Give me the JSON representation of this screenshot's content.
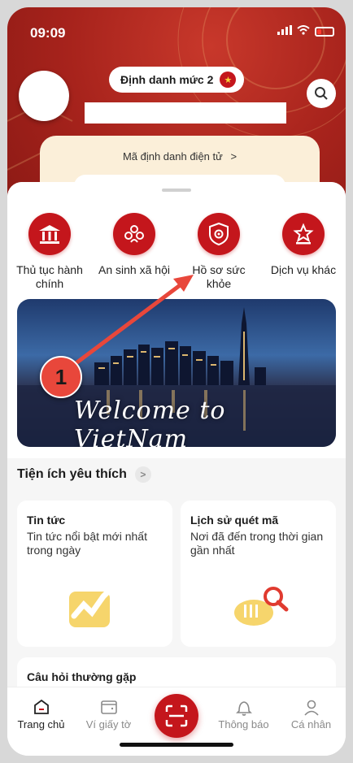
{
  "status_bar": {
    "time": "09:09",
    "signal_icon": "signal-icon",
    "wifi_icon": "wifi-icon",
    "battery_icon": "battery-icon"
  },
  "header": {
    "level_label": "Định danh mức 2",
    "id_card_label": "Mã định danh điện tử",
    "id_card_chevron": ">"
  },
  "services": [
    {
      "label": "Thủ tục hành chính",
      "icon": "building-icon",
      "glyph": "🏛"
    },
    {
      "label": "An sinh xã hội",
      "icon": "social-welfare-icon",
      "glyph": "✿"
    },
    {
      "label": "Hồ sơ sức khỏe",
      "icon": "health-shield-icon",
      "glyph": "⛨"
    },
    {
      "label": "Dịch vụ khác",
      "icon": "star-service-icon",
      "glyph": "☆"
    }
  ],
  "banner": {
    "text": "Welcome to VietNam"
  },
  "favorites": {
    "title": "Tiện ích yêu thích",
    "chevron": ">",
    "cards": [
      {
        "title": "Tin tức",
        "desc": "Tin tức nổi bật mới nhất trong ngày"
      },
      {
        "title": "Lịch sử quét mã",
        "desc": "Nơi đã đến trong thời gian gần nhất"
      }
    ]
  },
  "faq": {
    "title": "Câu hỏi thường gặp"
  },
  "tabbar": [
    {
      "label": "Trang chủ",
      "active": true
    },
    {
      "label": "Ví giấy tờ",
      "active": false
    },
    {
      "label": "",
      "active": false
    },
    {
      "label": "Thông báo",
      "active": false
    },
    {
      "label": "Cá nhân",
      "active": false
    }
  ],
  "annotation": {
    "step": "1"
  },
  "colors": {
    "brand_red": "#c4161c",
    "header_red": "#a7231c",
    "arrow_red": "#e8473b"
  }
}
